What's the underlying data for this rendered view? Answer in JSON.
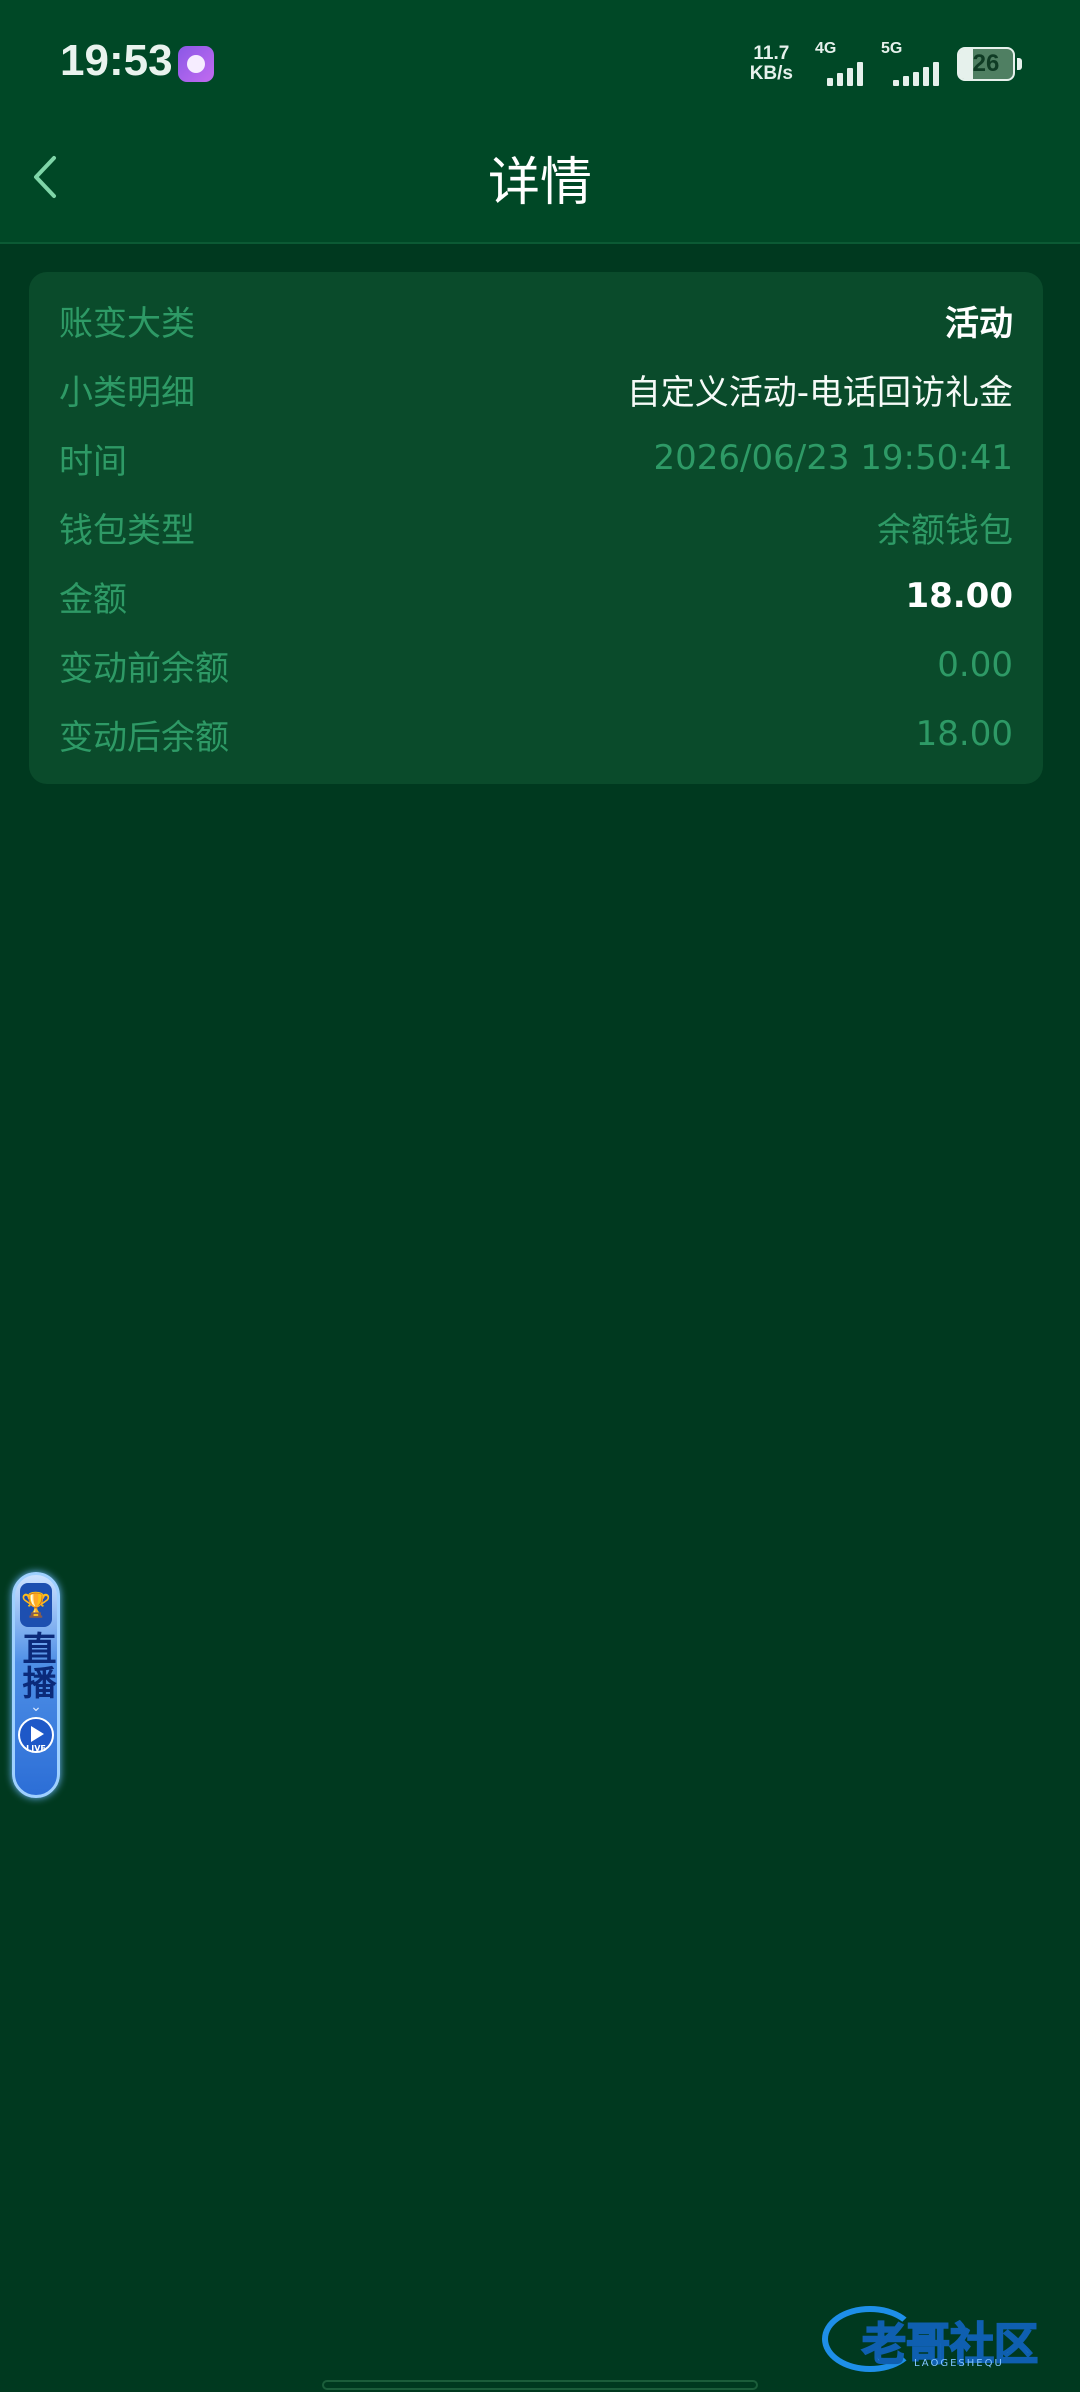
{
  "status_bar": {
    "time": "19:53",
    "net_speed_value": "11.7",
    "net_speed_unit": "KB/s",
    "signal_1_label": "4G",
    "signal_2_label": "5G",
    "battery": "26"
  },
  "header": {
    "title": "详情"
  },
  "details": [
    {
      "label": "账变大类",
      "value": "活动"
    },
    {
      "label": "小类明细",
      "value": "自定义活动-电话回访礼金"
    },
    {
      "label": "时间",
      "value": "2026/06/23 19:50:41"
    },
    {
      "label": "钱包类型",
      "value": "余额钱包"
    },
    {
      "label": "金额",
      "value": "18.00"
    },
    {
      "label": "变动前余额",
      "value": "0.00"
    },
    {
      "label": "变动后余额",
      "value": "18.00"
    }
  ],
  "live_widget": {
    "text": "直播",
    "badge": "LIVE"
  },
  "watermark": {
    "text": "老哥社区",
    "sub": "LAOGESHEQU"
  },
  "colors": {
    "background": "#00391f",
    "header": "#004826",
    "card": "#0a4b2b",
    "label": "#2e9a66"
  }
}
